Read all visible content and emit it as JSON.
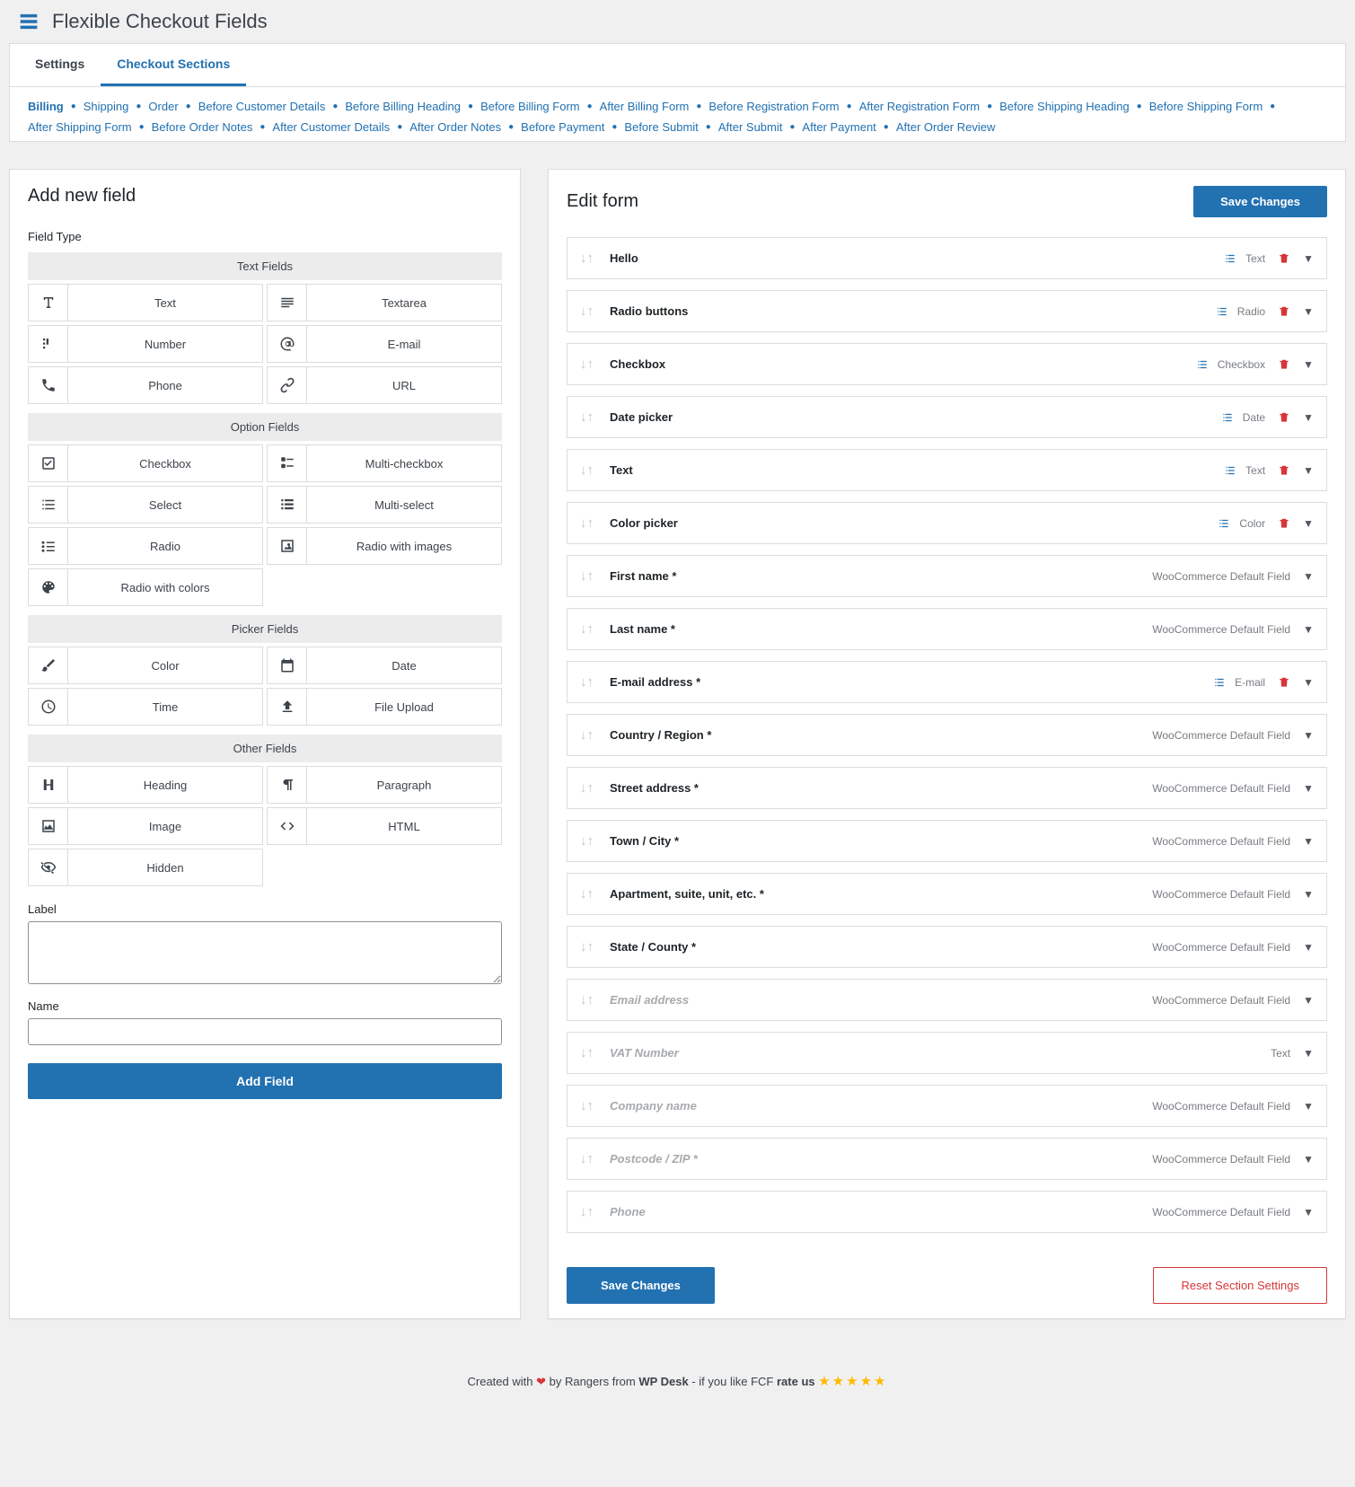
{
  "header": {
    "title": "Flexible Checkout Fields"
  },
  "tabs": [
    {
      "label": "Settings",
      "active": false
    },
    {
      "label": "Checkout Sections",
      "active": true
    }
  ],
  "sections": [
    "Billing",
    "Shipping",
    "Order",
    "Before Customer Details",
    "Before Billing Heading",
    "Before Billing Form",
    "After Billing Form",
    "Before Registration Form",
    "After Registration Form",
    "Before Shipping Heading",
    "Before Shipping Form",
    "After Shipping Form",
    "Before Order Notes",
    "After Customer Details",
    "After Order Notes",
    "Before Payment",
    "Before Submit",
    "After Submit",
    "After Payment",
    "After Order Review"
  ],
  "active_section": "Billing",
  "left": {
    "title": "Add new field",
    "field_type_label": "Field Type",
    "categories": [
      {
        "title": "Text Fields",
        "items": [
          {
            "label": "Text",
            "icon": "text"
          },
          {
            "label": "Textarea",
            "icon": "textarea"
          },
          {
            "label": "Number",
            "icon": "number"
          },
          {
            "label": "E-mail",
            "icon": "email"
          },
          {
            "label": "Phone",
            "icon": "phone"
          },
          {
            "label": "URL",
            "icon": "url"
          }
        ]
      },
      {
        "title": "Option Fields",
        "items": [
          {
            "label": "Checkbox",
            "icon": "checkbox"
          },
          {
            "label": "Multi-checkbox",
            "icon": "multicheckbox"
          },
          {
            "label": "Select",
            "icon": "select"
          },
          {
            "label": "Multi-select",
            "icon": "multiselect"
          },
          {
            "label": "Radio",
            "icon": "radio"
          },
          {
            "label": "Radio with images",
            "icon": "radioimg"
          },
          {
            "label": "Radio with colors",
            "icon": "radiocolor",
            "single": true
          }
        ]
      },
      {
        "title": "Picker Fields",
        "items": [
          {
            "label": "Color",
            "icon": "color"
          },
          {
            "label": "Date",
            "icon": "date"
          },
          {
            "label": "Time",
            "icon": "time"
          },
          {
            "label": "File Upload",
            "icon": "upload"
          }
        ]
      },
      {
        "title": "Other Fields",
        "items": [
          {
            "label": "Heading",
            "icon": "heading"
          },
          {
            "label": "Paragraph",
            "icon": "paragraph"
          },
          {
            "label": "Image",
            "icon": "image"
          },
          {
            "label": "HTML",
            "icon": "html"
          },
          {
            "label": "Hidden",
            "icon": "hidden",
            "single": true
          }
        ]
      }
    ],
    "label_label": "Label",
    "name_label": "Name",
    "add_button": "Add Field"
  },
  "right": {
    "title": "Edit form",
    "save_button": "Save Changes",
    "reset_button": "Reset Section Settings",
    "fields": [
      {
        "title": "Hello",
        "meta": "Text",
        "list_icon": true,
        "trash": true,
        "disabled": false
      },
      {
        "title": "Radio buttons",
        "meta": "Radio",
        "list_icon": true,
        "trash": true,
        "disabled": false
      },
      {
        "title": "Checkbox",
        "meta": "Checkbox",
        "list_icon": true,
        "trash": true,
        "disabled": false
      },
      {
        "title": "Date picker",
        "meta": "Date",
        "list_icon": true,
        "trash": true,
        "disabled": false
      },
      {
        "title": "Text",
        "meta": "Text",
        "list_icon": true,
        "trash": true,
        "disabled": false
      },
      {
        "title": "Color picker",
        "meta": "Color",
        "list_icon": true,
        "trash": true,
        "disabled": false
      },
      {
        "title": "First name *",
        "meta": "WooCommerce Default Field",
        "list_icon": false,
        "trash": false,
        "disabled": false
      },
      {
        "title": "Last name *",
        "meta": "WooCommerce Default Field",
        "list_icon": false,
        "trash": false,
        "disabled": false
      },
      {
        "title": "E-mail address *",
        "meta": "E-mail",
        "list_icon": true,
        "trash": true,
        "disabled": false
      },
      {
        "title": "Country / Region *",
        "meta": "WooCommerce Default Field",
        "list_icon": false,
        "trash": false,
        "disabled": false
      },
      {
        "title": "Street address *",
        "meta": "WooCommerce Default Field",
        "list_icon": false,
        "trash": false,
        "disabled": false
      },
      {
        "title": "Town / City *",
        "meta": "WooCommerce Default Field",
        "list_icon": false,
        "trash": false,
        "disabled": false
      },
      {
        "title": "Apartment, suite, unit, etc. *",
        "meta": "WooCommerce Default Field",
        "list_icon": false,
        "trash": false,
        "disabled": false
      },
      {
        "title": "State / County *",
        "meta": "WooCommerce Default Field",
        "list_icon": false,
        "trash": false,
        "disabled": false
      },
      {
        "title": "Email address",
        "meta": "WooCommerce Default Field",
        "list_icon": false,
        "trash": false,
        "disabled": true
      },
      {
        "title": "VAT Number",
        "meta": "Text",
        "list_icon": false,
        "trash": false,
        "disabled": true
      },
      {
        "title": "Company name",
        "meta": "WooCommerce Default Field",
        "list_icon": false,
        "trash": false,
        "disabled": true
      },
      {
        "title": "Postcode / ZIP *",
        "meta": "WooCommerce Default Field",
        "list_icon": false,
        "trash": false,
        "disabled": true
      },
      {
        "title": "Phone",
        "meta": "WooCommerce Default Field",
        "list_icon": false,
        "trash": false,
        "disabled": true
      }
    ]
  },
  "footer": {
    "prefix": "Created with ",
    "by": " by Rangers from ",
    "brand": "WP Desk",
    "suffix": " - if you like FCF ",
    "rate": "rate us "
  }
}
